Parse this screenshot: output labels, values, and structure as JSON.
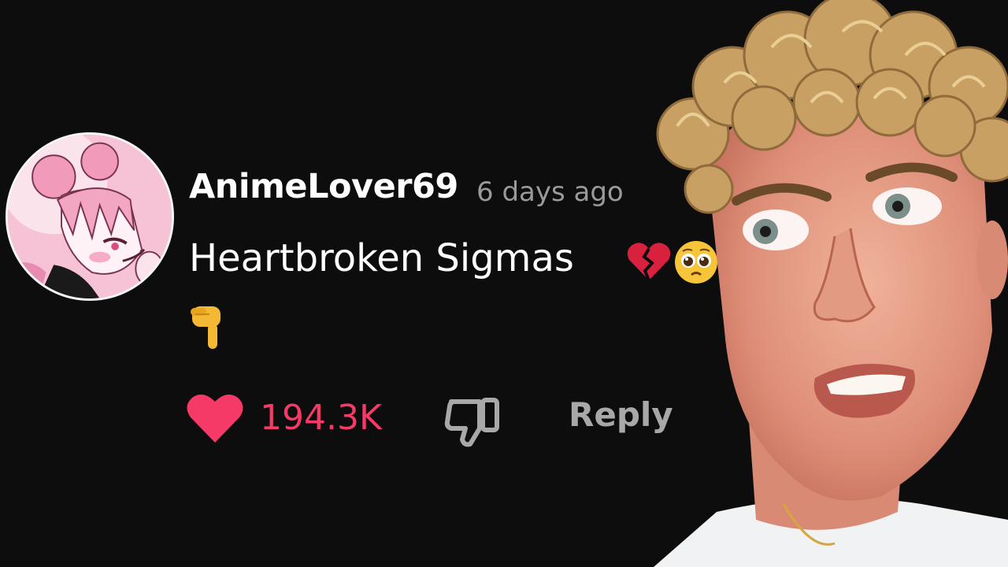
{
  "comment": {
    "username": "AnimeLover69",
    "timestamp": "6 days ago",
    "text": "Heartbroken Sigmas",
    "emojis": [
      "broken-heart-icon",
      "pleading-face-icon",
      "pointing-down-icon"
    ],
    "avatar": "anime-character-avatar"
  },
  "actions": {
    "like_count": "194.3K",
    "reply_label": "Reply"
  },
  "colors": {
    "background": "#0d0d0d",
    "like_accent": "#f53a68",
    "muted_text": "#9a9a9a"
  }
}
